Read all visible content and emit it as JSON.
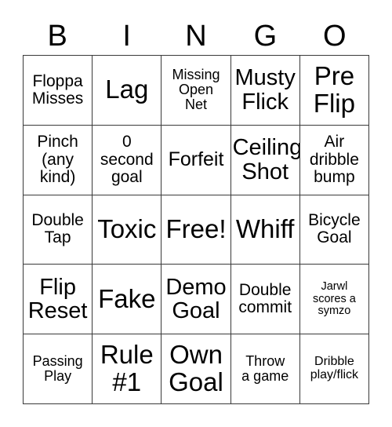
{
  "card": {
    "title": "BINGO",
    "header_letters": [
      "B",
      "I",
      "N",
      "G",
      "O"
    ],
    "colors": {
      "background": "#ffffff",
      "text": "#000000",
      "grid_line": "#3a3a3a"
    },
    "rows": [
      [
        {
          "text": "Floppa\nMisses",
          "size": "md",
          "marked": false
        },
        {
          "text": "Lag",
          "size": "xxl",
          "marked": false
        },
        {
          "text": "Missing\nOpen\nNet",
          "size": "sm",
          "marked": false
        },
        {
          "text": "Musty\nFlick",
          "size": "xl",
          "marked": false
        },
        {
          "text": "Pre\nFlip",
          "size": "xxl",
          "marked": false
        }
      ],
      [
        {
          "text": "Pinch\n(any\nkind)",
          "size": "md",
          "marked": false
        },
        {
          "text": "0\nsecond\ngoal",
          "size": "md",
          "marked": false
        },
        {
          "text": "Forfeit",
          "size": "lg",
          "marked": false
        },
        {
          "text": "Ceiling\nShot",
          "size": "xl",
          "marked": false
        },
        {
          "text": "Air\ndribble\nbump",
          "size": "md",
          "marked": false
        }
      ],
      [
        {
          "text": "Double\nTap",
          "size": "md",
          "marked": false
        },
        {
          "text": "Toxic",
          "size": "xxl",
          "marked": false
        },
        {
          "text": "Free!",
          "size": "xxl",
          "marked": true
        },
        {
          "text": "Whiff",
          "size": "xxl",
          "marked": false
        },
        {
          "text": "Bicycle\nGoal",
          "size": "md",
          "marked": false
        }
      ],
      [
        {
          "text": "Flip\nReset",
          "size": "xl",
          "marked": false
        },
        {
          "text": "Fake",
          "size": "xxl",
          "marked": false
        },
        {
          "text": "Demo\nGoal",
          "size": "xl",
          "marked": false
        },
        {
          "text": "Double\ncommit",
          "size": "md",
          "marked": false
        },
        {
          "text": "Jarwl\nscores a\nsymzo",
          "size": "xxs",
          "marked": false
        }
      ],
      [
        {
          "text": "Passing\nPlay",
          "size": "sm",
          "marked": false
        },
        {
          "text": "Rule\n#1",
          "size": "xxl",
          "marked": false
        },
        {
          "text": "Own\nGoal",
          "size": "xxl",
          "marked": false
        },
        {
          "text": "Throw\na game",
          "size": "sm",
          "marked": false
        },
        {
          "text": "Dribble\nplay/flick",
          "size": "xs",
          "marked": false
        }
      ]
    ]
  }
}
